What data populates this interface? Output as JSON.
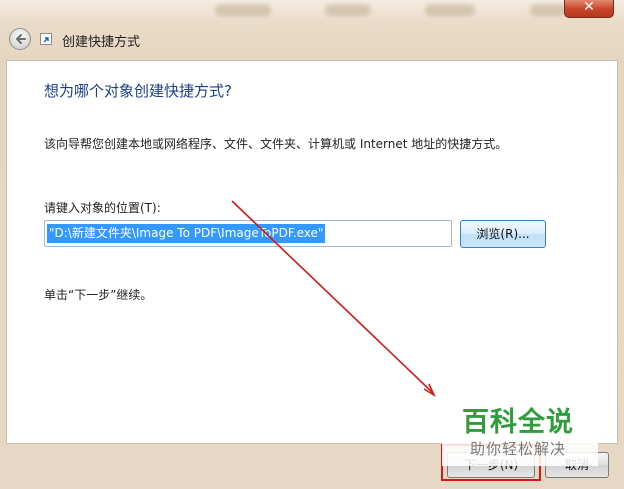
{
  "window": {
    "title": "创建快捷方式",
    "close_glyph": "✕"
  },
  "content": {
    "heading": "想为哪个对象创建快捷方式?",
    "description": "该向导帮您创建本地或网络程序、文件、文件夹、计算机或 Internet 地址的快捷方式。",
    "location_label": "请键入对象的位置(T):",
    "location_value": "\"D:\\新建文件夹\\Image To PDF\\ImageToPDF.exe\"",
    "browse_label": "浏览(R)...",
    "hint": "单击“下一步”继续。"
  },
  "footer": {
    "next_label": "下一步(N)",
    "cancel_label": "取消"
  },
  "watermark": {
    "logo": "百科全说",
    "tagline": "助你轻松解决"
  },
  "icons": {
    "back": "back-arrow-icon",
    "wizard": "shortcut-wizard-icon",
    "close": "close-icon"
  },
  "colors": {
    "heading": "#1d3f8c",
    "selection": "#3399ff",
    "annotation": "#d21a1a",
    "watermark": "#2f9d3e"
  }
}
